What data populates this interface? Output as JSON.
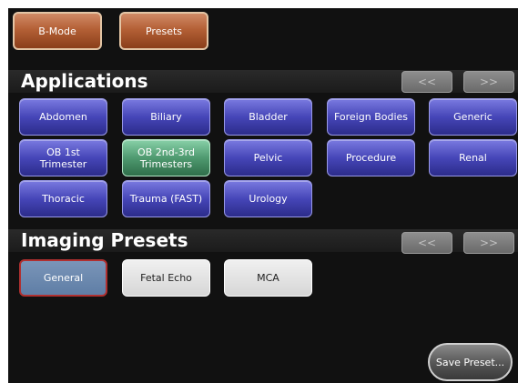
{
  "mode_buttons": [
    {
      "label": "B-Mode"
    },
    {
      "label": "Presets"
    }
  ],
  "applications": {
    "title": "Applications",
    "prev_label": "<<",
    "next_label": ">>",
    "items": [
      {
        "label": "Abdomen"
      },
      {
        "label": "Biliary"
      },
      {
        "label": "Bladder"
      },
      {
        "label": "Foreign Bodies"
      },
      {
        "label": "Generic"
      },
      {
        "label": "OB 1st\nTrimester"
      },
      {
        "label": "OB 2nd-3rd\nTrimesters",
        "selected": true
      },
      {
        "label": "Pelvic"
      },
      {
        "label": "Procedure"
      },
      {
        "label": "Renal"
      },
      {
        "label": "Thoracic"
      },
      {
        "label": "Trauma (FAST)"
      },
      {
        "label": "Urology"
      }
    ]
  },
  "imaging_presets": {
    "title": "Imaging Presets",
    "prev_label": "<<",
    "next_label": ">>",
    "items": [
      {
        "label": "General",
        "selected": true
      },
      {
        "label": "Fetal Echo"
      },
      {
        "label": "MCA"
      }
    ]
  },
  "save_preset_label": "Save Preset..."
}
